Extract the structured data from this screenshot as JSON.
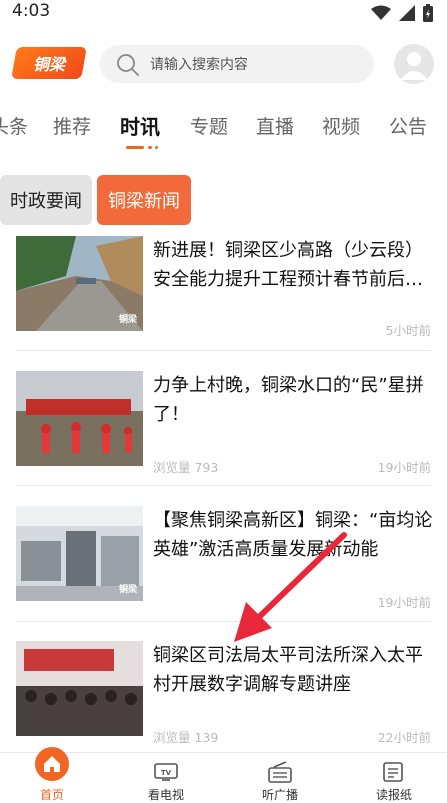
{
  "status": {
    "time": "4:03"
  },
  "header": {
    "logo_text": "铜梁",
    "search_placeholder": "请输入搜索内容"
  },
  "tabs": [
    {
      "label": "头条"
    },
    {
      "label": "推荐"
    },
    {
      "label": "时讯",
      "active": true
    },
    {
      "label": "专题"
    },
    {
      "label": "直播"
    },
    {
      "label": "视频"
    },
    {
      "label": "公告"
    }
  ],
  "subtabs": [
    {
      "label": "时政要闻"
    },
    {
      "label": "铜梁新闻",
      "active": true
    }
  ],
  "news": [
    {
      "title": "新进展！铜梁区少高路（少云段）安全能力提升工程预计春节前后通车",
      "views": "",
      "time": "5小时前",
      "watermark": "铜梁"
    },
    {
      "title": "力争上村晚，铜梁水口的“民”星拼了！",
      "views": "浏览量 793",
      "time": "19小时前",
      "watermark": ""
    },
    {
      "title": "【聚焦铜梁高新区】铜梁：“亩均论英雄”激活高质量发展新动能",
      "views": "",
      "time": "19小时前",
      "watermark": "铜梁"
    },
    {
      "title": "铜梁区司法局太平司法所深入太平村开展数字调解专题讲座",
      "views": "浏览量 139",
      "time": "22小时前",
      "watermark": ""
    }
  ],
  "bottom_nav": [
    {
      "label": "首页",
      "icon": "home-icon",
      "active": true
    },
    {
      "label": "看电视",
      "icon": "tv-icon"
    },
    {
      "label": "听广播",
      "icon": "radio-icon"
    },
    {
      "label": "读报纸",
      "icon": "newspaper-icon"
    }
  ],
  "colors": {
    "accent": "#f26522",
    "arrow": "#e8283a"
  }
}
